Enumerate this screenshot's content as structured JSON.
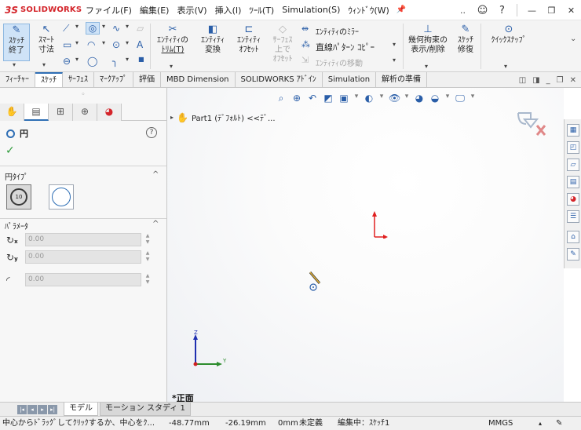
{
  "app": {
    "ds_mark": "3S",
    "brand": "SOLIDWORKS"
  },
  "menu": [
    "ファイル(F)",
    "編集(E)",
    "表示(V)",
    "挿入(I)",
    "ﾂｰﾙ(T)",
    "Simulation(S)",
    "ｳｨﾝﾄﾞｳ(W)"
  ],
  "window_controls": {
    "more": "..",
    "minimize": "—",
    "restore": "❐",
    "close": "✕"
  },
  "ribbon": {
    "sketch_exit_line1": "ｽｹｯﾁ",
    "sketch_exit_line2": "終了",
    "smart_dim_line1": "ｽﾏｰﾄ",
    "smart_dim_line2": "寸法",
    "trim_line1": "ｴﾝﾃｨﾃｨの",
    "trim_line2": "ﾄﾘﾑ(T)",
    "convert_line1": "ｴﾝﾃｨﾃｨ",
    "convert_line2": "変換",
    "offset_line1": "ｴﾝﾃｨﾃｨ",
    "offset_line2": "ｵﾌｾｯﾄ",
    "surface_offset_line1": "ｻｰﾌｪｽ",
    "surface_offset_line2": "上で",
    "surface_offset_line3": "ｵﾌｾｯﾄ",
    "mirror": "ｴﾝﾃｨﾃｨのﾐﾗｰ",
    "linear_pattern": "直線ﾊﾟﾀｰﾝ ｺﾋﾟｰ",
    "move_entities": "ｴﾝﾃｨﾃｨの移動",
    "relations_line1": "幾何拘束の",
    "relations_line2": "表示/削除",
    "repair_line1": "ｽｹｯﾁ",
    "repair_line2": "修復",
    "quick_snap": "ｸｲｯｸｽﾅｯﾌﾟ"
  },
  "tabs": [
    "ﾌｨｰﾁｬｰ",
    "ｽｹｯﾁ",
    "ｻｰﾌｪｽ",
    "ﾏｰｸｱｯﾌﾟ",
    "評価",
    "MBD Dimension",
    "SOLIDWORKS ｱﾄﾞｲﾝ",
    "Simulation",
    "解析の準備"
  ],
  "active_tab_index": 1,
  "property_manager": {
    "title": "円",
    "help": "?",
    "circle_type_header": "円ﾀｲﾌﾟ",
    "circle_type_center_label": "10",
    "params_header": "ﾊﾟﾗﾒｰﾀ",
    "params": [
      {
        "sub": "x",
        "value": "0.00"
      },
      {
        "sub": "y",
        "value": "0.00"
      },
      {
        "sub": "",
        "value": "0.00"
      }
    ]
  },
  "tree": {
    "part_label": "Part1 (ﾃﾞﾌｫﾙﾄ) <<ﾃﾞ..."
  },
  "view_label": "*正面",
  "triad": {
    "x": "Y",
    "z": "Z"
  },
  "bottom_tabs": {
    "model": "モデル",
    "motion": "モーション スタディ 1"
  },
  "status": {
    "message": "中心からﾄﾞﾗｯｸﾞしてｸﾘｯｸするか、中心をｸ...",
    "x": "-48.77mm",
    "y": "-26.19mm",
    "z": "0mm",
    "defined": "未定義",
    "editing": "編集中：ｽｹｯﾁ1",
    "units": "MMGS"
  },
  "colors": {
    "accent": "#2f6fb5",
    "brand": "#d4242a",
    "ok": "#2e9b3a",
    "origin": "#e02020"
  }
}
